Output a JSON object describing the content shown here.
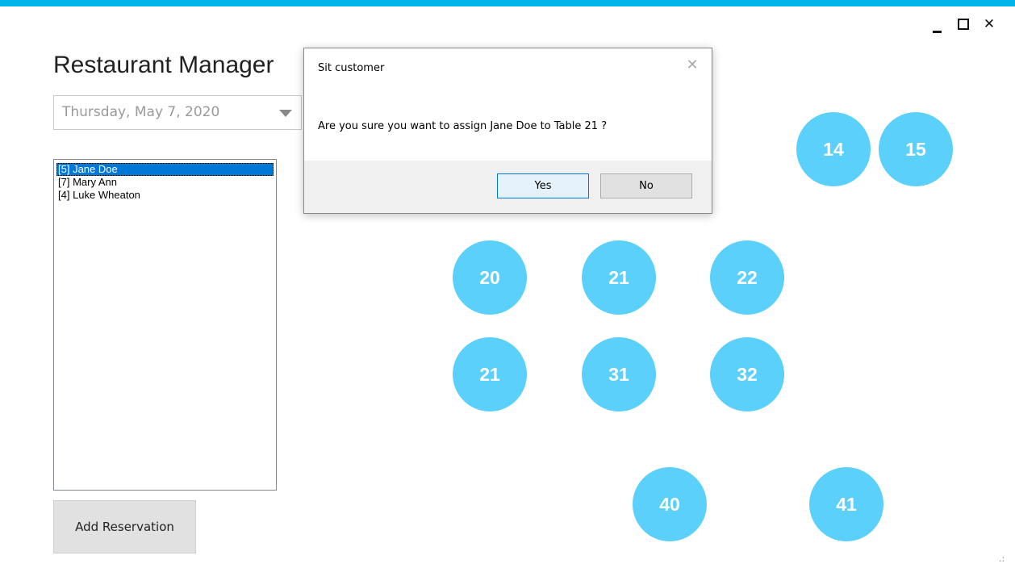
{
  "colors": {
    "accent_bar": "#00b4ea",
    "table_fill": "#5bd0fb",
    "selection": "#0078d7"
  },
  "window_controls": {
    "minimize_icon": "minimize-icon",
    "maximize_icon": "maximize-icon",
    "close_glyph": "✕"
  },
  "app": {
    "title": "Restaurant Manager"
  },
  "date_picker": {
    "value": "Thursday, May 7, 2020",
    "icon": "dropdown-arrow-icon"
  },
  "reservations": [
    {
      "label": "[5] Jane Doe",
      "selected": true
    },
    {
      "label": "[7] Mary Ann",
      "selected": false
    },
    {
      "label": "[4] Luke Wheaton",
      "selected": false
    }
  ],
  "add_reservation_label": "Add Reservation",
  "tables": [
    "14",
    "15",
    "20",
    "21",
    "22",
    "21",
    "31",
    "32",
    "40",
    "41"
  ],
  "dialog": {
    "title": "Sit customer",
    "close_glyph": "✕",
    "message": "Are you sure you want to assign Jane Doe to Table 21 ?",
    "yes_label": "Yes",
    "no_label": "No"
  },
  "resize_grip_glyph": ".:"
}
